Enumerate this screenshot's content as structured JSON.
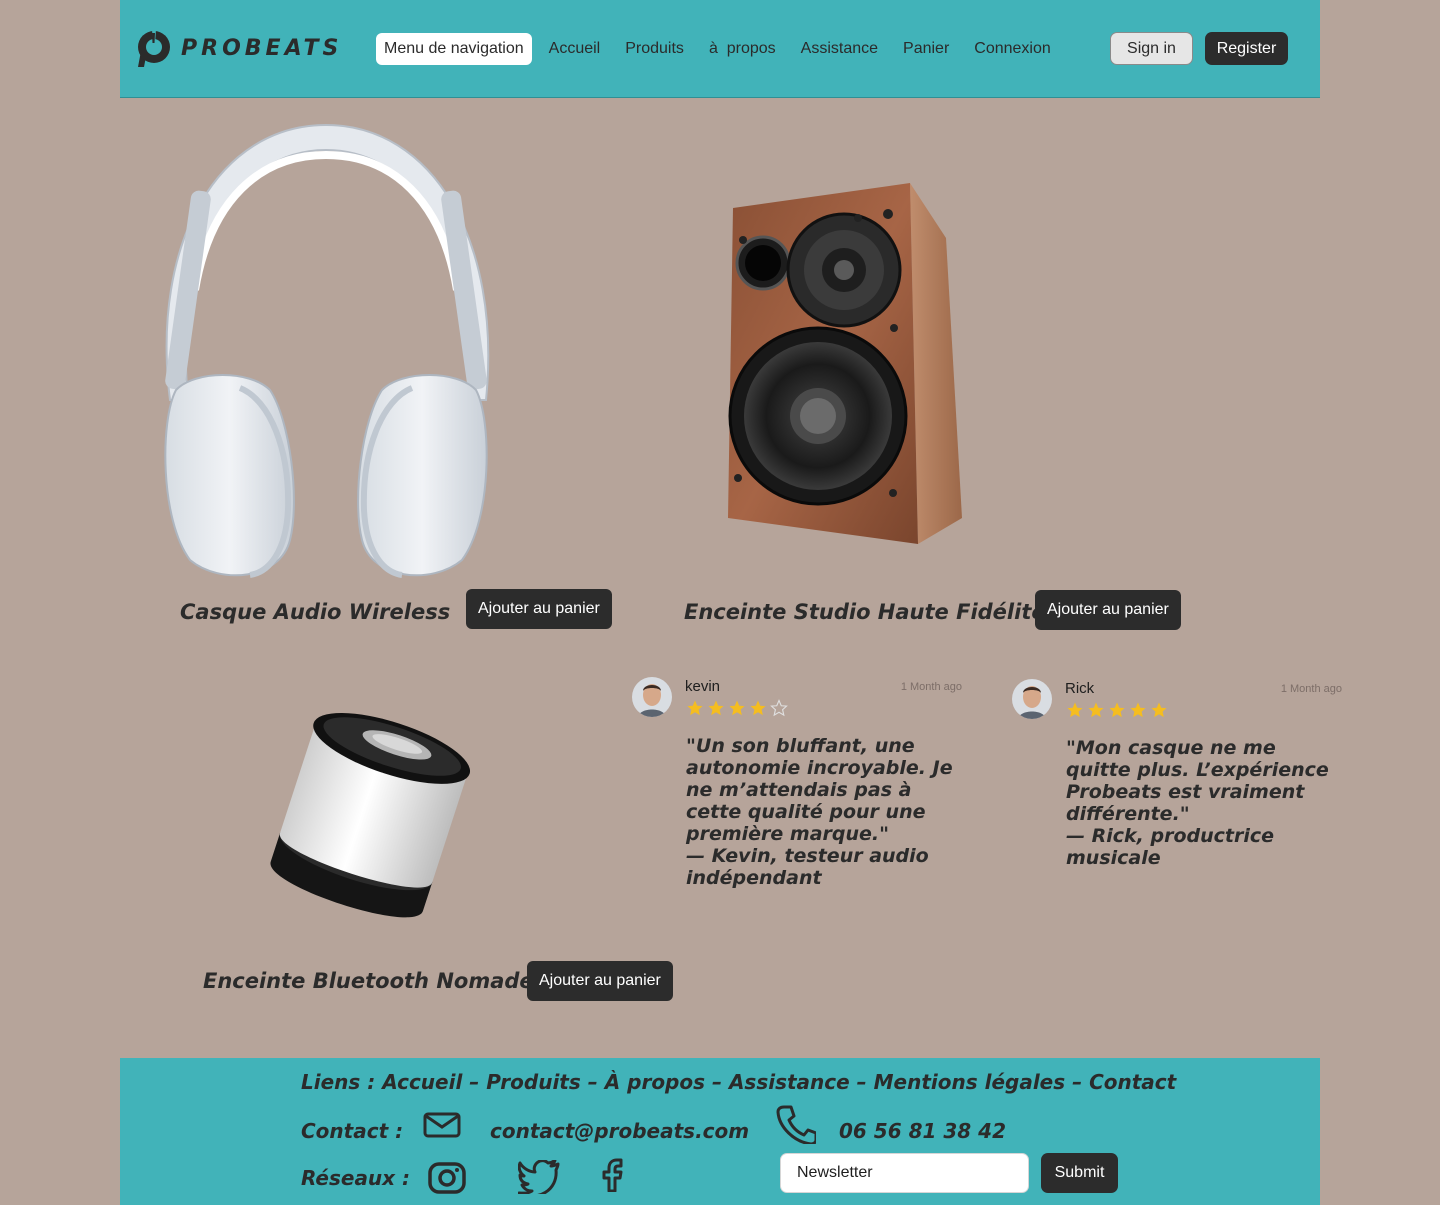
{
  "header": {
    "logo_text": "PROBEATS",
    "nav": [
      "Menu de navigation",
      "Accueil",
      "Produits",
      "à  propos",
      "Assistance",
      "Panier",
      "Connexion"
    ],
    "sign_in": "Sign in",
    "register": "Register"
  },
  "products": [
    {
      "name": "Casque Audio Wireless",
      "button": "Ajouter au panier",
      "image": "headphones-image"
    },
    {
      "name": "Enceinte Studio Haute Fidélité",
      "button": "Ajouter au panier",
      "image": "studio-speaker-image"
    },
    {
      "name": "Enceinte Bluetooth Nomade",
      "button": "Ajouter au panier",
      "image": "bluetooth-speaker-image"
    }
  ],
  "reviews": [
    {
      "name": "kevin",
      "date": "1 Month ago",
      "rating": 4,
      "quote": " \"Un son bluffant, une autonomie incroyable. Je ne m’attendais pas à cette qualité pour une première marque.\"\n — Kevin, testeur audio indépendant"
    },
    {
      "name": "Rick",
      "date": "1 Month ago",
      "rating": 5,
      "quote": " \"Mon casque ne me quitte plus. L’expérience Probeats est vraiment différente.\"\n — Rick, productrice musicale"
    }
  ],
  "footer": {
    "links": "Liens : Accueil – Produits – À propos – Assistance – Mentions légales – Contact",
    "contact_label": "Contact :",
    "email": "contact@probeats.com",
    "phone": "06 56 81 38 42",
    "social_label": "Réseaux :",
    "social_icons": [
      "instagram-icon",
      "twitter-icon",
      "facebook-icon"
    ],
    "newsletter_placeholder": "Newsletter",
    "submit": "Submit"
  },
  "colors": {
    "background": "#b6a49a",
    "header": "#41b3b9",
    "dark_button": "#2c2c2c",
    "star": "#f5bd1f"
  }
}
